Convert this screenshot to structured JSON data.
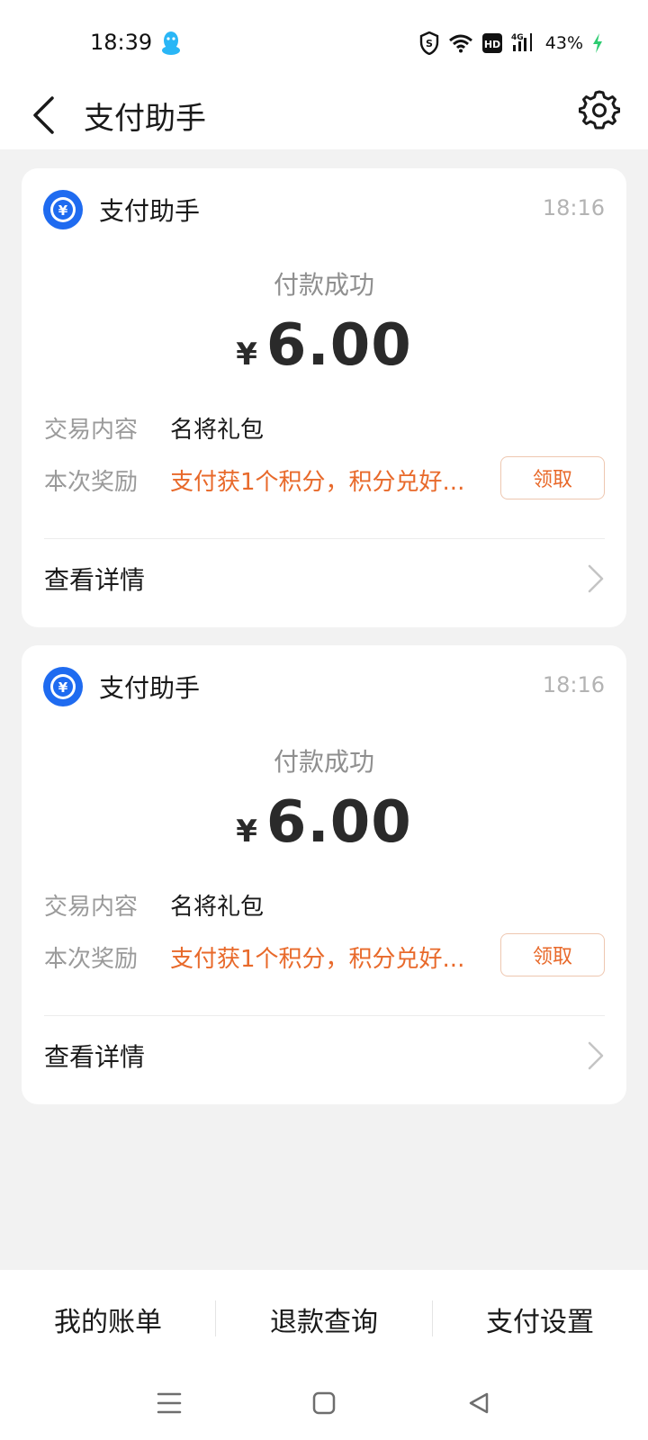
{
  "status_bar": {
    "time": "18:39",
    "battery": "43%",
    "network": "4G",
    "hd_label": "HD",
    "icons": [
      "qq-icon",
      "vpn-shield-icon",
      "wifi-icon",
      "hd-icon",
      "signal-icon",
      "charging-icon"
    ]
  },
  "header": {
    "title": "支付助手",
    "back_icon": "back-arrow-icon",
    "settings_icon": "gear-icon"
  },
  "messages": [
    {
      "app_name": "支付助手",
      "time": "18:16",
      "status": "付款成功",
      "currency": "¥",
      "amount": "6.00",
      "content_label": "交易内容",
      "content_value": "名将礼包",
      "reward_label": "本次奖励",
      "reward_value": "支付获1个积分，积分兑好...",
      "claim_label": "领取",
      "details_label": "查看详情"
    },
    {
      "app_name": "支付助手",
      "time": "18:16",
      "status": "付款成功",
      "currency": "¥",
      "amount": "6.00",
      "content_label": "交易内容",
      "content_value": "名将礼包",
      "reward_label": "本次奖励",
      "reward_value": "支付获1个积分，积分兑好...",
      "claim_label": "领取",
      "details_label": "查看详情"
    }
  ],
  "bottom_tabs": [
    {
      "label": "我的账单"
    },
    {
      "label": "退款查询"
    },
    {
      "label": "支付设置"
    }
  ],
  "colors": {
    "accent": "#e8692a",
    "brand_blue": "#1f6bf0",
    "background": "#f2f2f2"
  }
}
